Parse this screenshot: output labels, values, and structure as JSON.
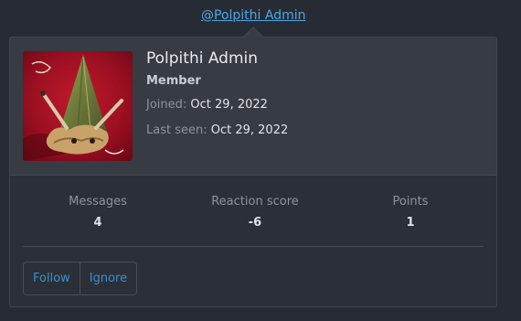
{
  "mention": {
    "text": "@Polpithi Admin"
  },
  "profile": {
    "name": "Polpithi Admin",
    "title": "Member",
    "joined_label": "Joined:",
    "joined_value": "Oct 29, 2022",
    "last_seen_label": "Last seen:",
    "last_seen_value": "Oct 29, 2022"
  },
  "stats": [
    {
      "label": "Messages",
      "value": "4"
    },
    {
      "label": "Reaction score",
      "value": "-6"
    },
    {
      "label": "Points",
      "value": "1"
    }
  ],
  "actions": {
    "follow_label": "Follow",
    "ignore_label": "Ignore"
  },
  "colors": {
    "background": "#272b33",
    "card": "#2b2f37",
    "card_header": "#363b44",
    "link": "#4ea6e3",
    "button_text": "#3b8fcf"
  }
}
